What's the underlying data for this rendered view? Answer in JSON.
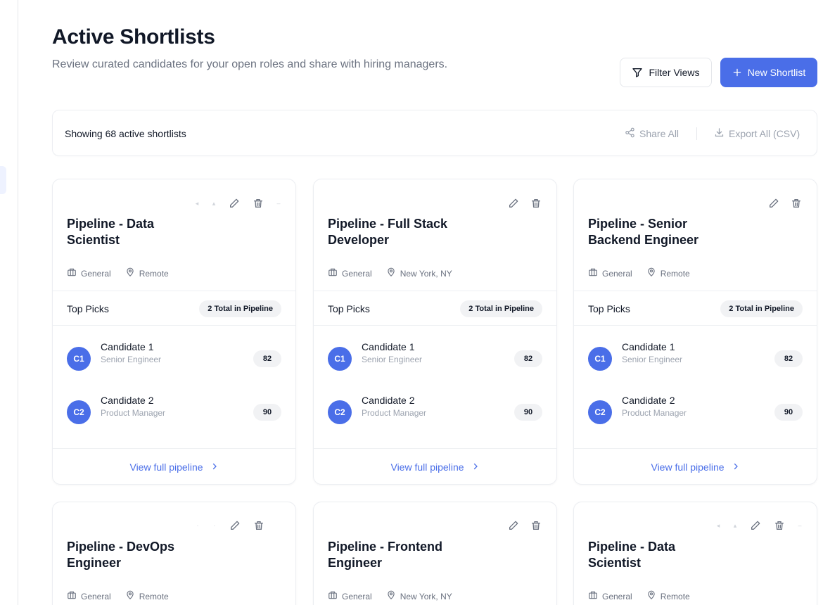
{
  "header": {
    "title": "Active Shortlists",
    "subtitle": "Review curated candidates for your open roles and share with hiring managers."
  },
  "actions": {
    "filter_views": "Filter Views",
    "new_shortlist": "New Shortlist"
  },
  "toolbar": {
    "count_text": "Showing 68 active shortlists",
    "share_all": "Share All",
    "export_all": "Export All (CSV)"
  },
  "cards": [
    {
      "title": "Pipeline - Data Scientist",
      "department": "General",
      "location": "Remote",
      "picks_label": "Top Picks",
      "total_badge": "2 Total in Pipeline",
      "candidates": [
        {
          "initials": "C1",
          "name": "Candidate 1",
          "role": "Senior Engineer",
          "score": "82"
        },
        {
          "initials": "C2",
          "name": "Candidate 2",
          "role": "Product Manager",
          "score": "90"
        }
      ],
      "view_link": "View full pipeline"
    },
    {
      "title": "Pipeline - Full Stack Developer",
      "department": "General",
      "location": "New York, NY",
      "picks_label": "Top Picks",
      "total_badge": "2 Total in Pipeline",
      "candidates": [
        {
          "initials": "C1",
          "name": "Candidate 1",
          "role": "Senior Engineer",
          "score": "82"
        },
        {
          "initials": "C2",
          "name": "Candidate 2",
          "role": "Product Manager",
          "score": "90"
        }
      ],
      "view_link": "View full pipeline"
    },
    {
      "title": "Pipeline - Senior Backend Engineer",
      "department": "General",
      "location": "Remote",
      "picks_label": "Top Picks",
      "total_badge": "2 Total in Pipeline",
      "candidates": [
        {
          "initials": "C1",
          "name": "Candidate 1",
          "role": "Senior Engineer",
          "score": "82"
        },
        {
          "initials": "C2",
          "name": "Candidate 2",
          "role": "Product Manager",
          "score": "90"
        }
      ],
      "view_link": "View full pipeline"
    },
    {
      "title": "Pipeline - DevOps Engineer",
      "department": "General",
      "location": "Remote"
    },
    {
      "title": "Pipeline - Frontend Engineer",
      "department": "General",
      "location": "New York, NY"
    },
    {
      "title": "Pipeline - Data Scientist",
      "department": "General",
      "location": "Remote"
    }
  ],
  "icons": {
    "filter": "filter-icon",
    "plus": "plus-icon",
    "share": "share-icon",
    "download": "download-icon",
    "edit": "pencil-icon",
    "delete": "trash-icon",
    "department": "briefcase-icon",
    "location": "map-pin-icon",
    "chevron": "chevron-right-icon"
  },
  "colors": {
    "accent": "#4a6ee8",
    "text_primary": "#111827",
    "text_muted": "#6b7280",
    "badge_bg": "#f1f2f4"
  }
}
